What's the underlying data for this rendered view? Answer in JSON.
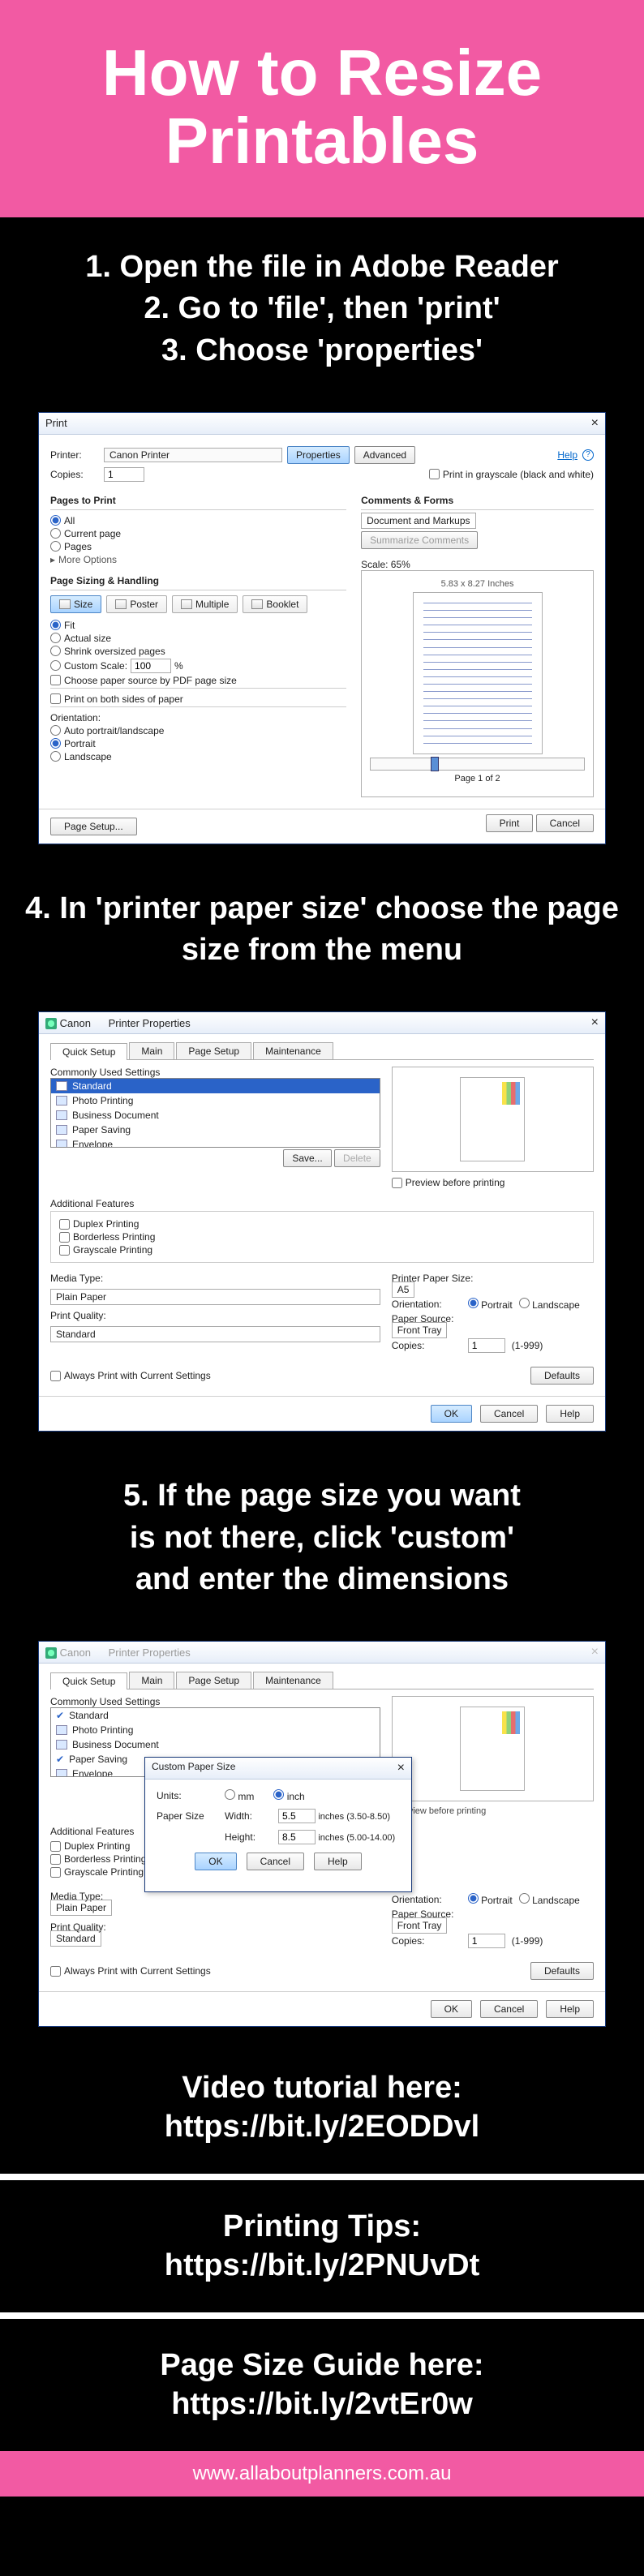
{
  "header": {
    "title": "How to Resize Printables"
  },
  "steps_a": {
    "l1": "1. Open the file in Adobe Reader",
    "l2": "2. Go to 'file', then 'print'",
    "l3": "3. Choose 'properties'"
  },
  "shot1": {
    "title": "Print",
    "printer_label": "Printer:",
    "printer_value": "Canon                Printer",
    "copies_label": "Copies:",
    "copies_value": "1",
    "btn_properties": "Properties",
    "btn_advanced": "Advanced",
    "help": "Help",
    "cb_grayscale": "Print in grayscale (black and white)",
    "sec_pages": "Pages to Print",
    "r_all": "All",
    "r_current": "Current page",
    "r_pages": "Pages",
    "more_opts": "More Options",
    "sec_sizing": "Page Sizing & Handling",
    "tab_size": "Size",
    "tab_poster": "Poster",
    "tab_multiple": "Multiple",
    "tab_booklet": "Booklet",
    "r_fit": "Fit",
    "r_actual": "Actual size",
    "r_shrink": "Shrink oversized pages",
    "r_custom_scale": "Custom Scale:",
    "custom_scale_val": "100",
    "pct": "%",
    "cb_pdfsrc": "Choose paper source by PDF page size",
    "cb_bothsides": "Print on both sides of paper",
    "sec_orient": "Orientation:",
    "r_autoorient": "Auto portrait/landscape",
    "r_portrait": "Portrait",
    "r_landscape": "Landscape",
    "sec_comments": "Comments & Forms",
    "comments_val": "Document and Markups",
    "btn_summarize": "Summarize Comments",
    "scale_label": "Scale:  65%",
    "preview_size": "5.83 x 8.27 Inches",
    "pager": "Page 1 of 2",
    "btn_pagesetup": "Page Setup...",
    "btn_print": "Print",
    "btn_cancel": "Cancel"
  },
  "step4": "4. In 'printer paper size' choose the page size from the menu",
  "shot2": {
    "titlebar_app": "Canon",
    "titlebar_text": "Printer Properties",
    "tabs": {
      "t1": "Quick Setup",
      "t2": "Main",
      "t3": "Page Setup",
      "t4": "Maintenance"
    },
    "sec_used": "Commonly Used Settings",
    "items": {
      "i1": "Standard",
      "i2": "Photo Printing",
      "i3": "Business Document",
      "i4": "Paper Saving",
      "i5": "Envelope"
    },
    "btn_save": "Save...",
    "btn_delete": "Delete",
    "cb_preview": "Preview before printing",
    "sec_addl": "Additional Features",
    "cb_duplex": "Duplex Printing",
    "cb_borderless": "Borderless Printing",
    "cb_grayscale": "Grayscale Printing",
    "media_type": "Media Type:",
    "media_val": "Plain Paper",
    "quality": "Print Quality:",
    "quality_val": "Standard",
    "paper_size": "Printer Paper Size:",
    "paper_val": "A5",
    "orient": "Orientation:",
    "r_portrait": "Portrait",
    "r_landscape": "Landscape",
    "source": "Paper Source:",
    "source_val": "Front Tray",
    "copies_l": "Copies:",
    "copies_v": "1",
    "copies_range": "(1-999)",
    "cb_always": "Always Print with Current Settings",
    "btn_defaults": "Defaults",
    "btn_ok": "OK",
    "btn_cancel": "Cancel",
    "btn_help": "Help"
  },
  "step5": {
    "l1": "5. If the page size you want",
    "l2": "is not there, click 'custom'",
    "l3": "and enter the dimensions"
  },
  "shot3": {
    "custom_title": "Custom Paper Size",
    "units": "Units:",
    "u_mm": "mm",
    "u_inch": "inch",
    "papersize": "Paper Size",
    "width_l": "Width:",
    "width_v": "5.5",
    "width_range": "inches (3.50-8.50)",
    "height_l": "Height:",
    "height_v": "8.5",
    "height_range": "inches (5.00-14.00)",
    "btn_ok": "OK",
    "btn_cancel": "Cancel",
    "btn_help": "Help"
  },
  "links": {
    "video_t": "Video tutorial here:",
    "video_u": "https://bit.ly/2EODDvl",
    "tips_t": "Printing Tips:",
    "tips_u": "https://bit.ly/2PNUvDt",
    "guide_t": "Page Size Guide here:",
    "guide_u": "https://bit.ly/2vtEr0w"
  },
  "footer": {
    "url": "www.allaboutplanners.com.au"
  }
}
